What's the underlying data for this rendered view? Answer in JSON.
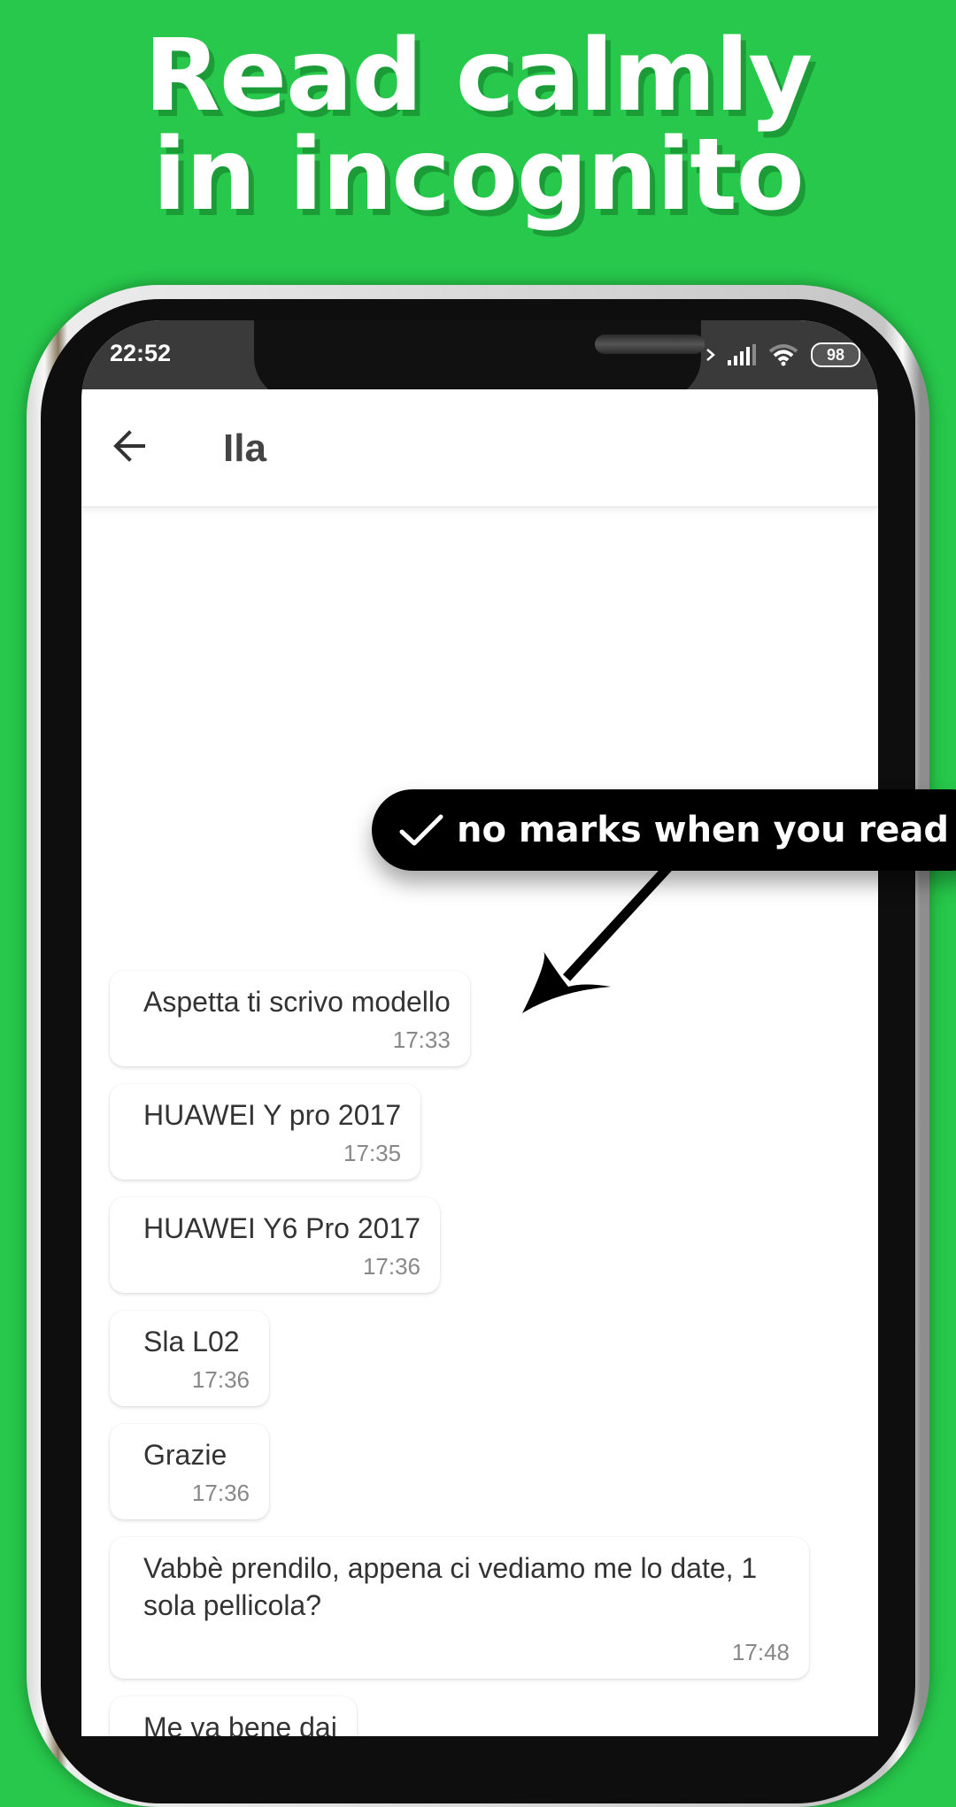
{
  "promo": {
    "headline_line1": "Read calmly",
    "headline_line2": "in incognito",
    "background_color": "#27c84b"
  },
  "statusbar": {
    "time": "22:52",
    "battery_percent": "98",
    "icons": [
      "bluetooth-icon",
      "signal-icon",
      "wifi-icon",
      "battery-icon"
    ]
  },
  "appbar": {
    "back_icon": "arrow-left-icon",
    "title": "Ila"
  },
  "annotation": {
    "icon": "checkmark-icon",
    "text": "no marks when you read"
  },
  "messages": [
    {
      "text": "Aspetta ti scrivo modello",
      "time": "17:33"
    },
    {
      "text": "HUAWEI Y pro 2017",
      "time": "17:35"
    },
    {
      "text": "HUAWEI Y6 Pro 2017",
      "time": "17:36"
    },
    {
      "text": "Sla L02",
      "time": "17:36"
    },
    {
      "text": "Grazie",
      "time": "17:36"
    },
    {
      "text": "Vabbè prendilo, appena ci vediamo me lo date, 1 sola pellicola?",
      "time": "17:48"
    },
    {
      "text": "Me va bene dai",
      "time": ""
    }
  ]
}
